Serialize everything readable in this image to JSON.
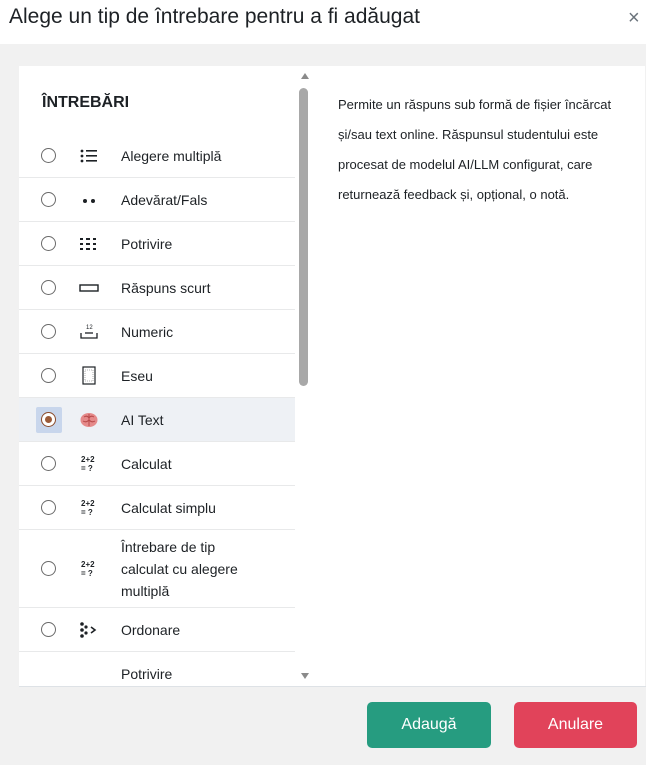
{
  "dialog": {
    "title": "Alege un tip de întrebare pentru a fi adăugat",
    "close_glyph": "×"
  },
  "section": {
    "title": "ÎNTREBĂRI"
  },
  "questions": [
    {
      "label": "Alegere multiplă",
      "icon": "list-icon",
      "glyph": "⁝☰"
    },
    {
      "label": "Adevărat/Fals",
      "icon": "two-dots-icon",
      "glyph": "••"
    },
    {
      "label": "Potrivire",
      "icon": "grid-list-icon",
      "glyph": "⁝☰"
    },
    {
      "label": "Răspuns scurt",
      "icon": "text-box-icon",
      "glyph": "▭"
    },
    {
      "label": "Numeric",
      "icon": "numeric-icon",
      "glyph": "¹²"
    },
    {
      "label": "Eseu",
      "icon": "document-icon",
      "glyph": "▤"
    },
    {
      "label": "AI Text",
      "icon": "brain-icon",
      "glyph": "🧠",
      "selected": true
    },
    {
      "label": "Calculat",
      "icon": "calc-icon",
      "glyph": "2+2\n= ?"
    },
    {
      "label": "Calculat simplu",
      "icon": "calc-simple-icon",
      "glyph": "2+2\n= ?"
    },
    {
      "label": "Întrebare de tip\ncalculat cu alegere\nmultiplă",
      "icon": "calc-multi-icon",
      "glyph": "2+2\n= ?"
    },
    {
      "label": "Ordonare",
      "icon": "ordering-icon",
      "glyph": "⁘›"
    },
    {
      "label": "Potrivire",
      "icon": "none",
      "glyph": ""
    }
  ],
  "description": "Permite un răspuns sub formă de fișier încărcat și/sau text online. Răspunsul studentului este procesat de modelul AI/LLM configurat, care returnează feedback și, opțional, o notă.",
  "buttons": {
    "add": "Adaugă",
    "cancel": "Anulare"
  },
  "colors": {
    "add": "#269c80",
    "cancel": "#e1435a",
    "selected_radio": "#9b5a38"
  }
}
